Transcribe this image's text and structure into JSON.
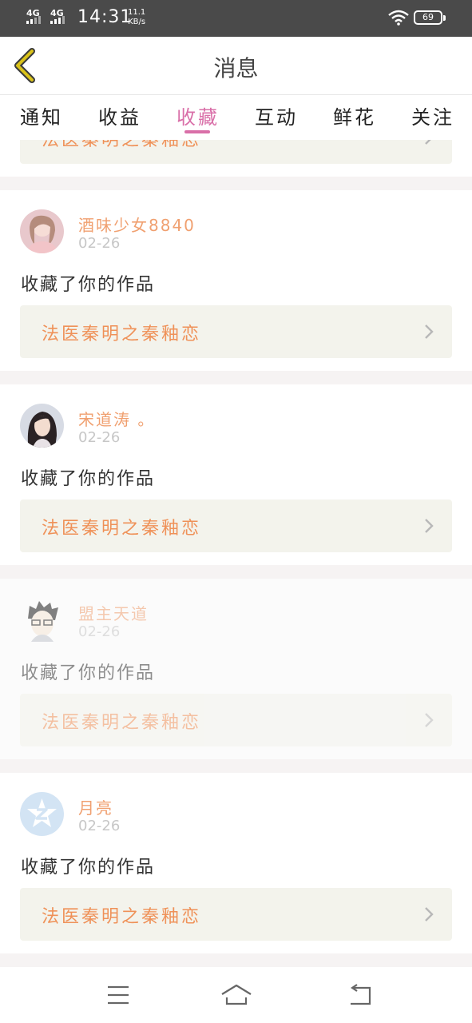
{
  "status_bar": {
    "network_1": "4G",
    "network_2": "4G",
    "time": "14:31",
    "speed_value": "11.1",
    "speed_unit": "KB/s",
    "battery": "69"
  },
  "header": {
    "title": "消息"
  },
  "tabs": [
    {
      "label": "通知"
    },
    {
      "label": "收益"
    },
    {
      "label": "收藏"
    },
    {
      "label": "互动"
    },
    {
      "label": "鲜花"
    },
    {
      "label": "关注"
    }
  ],
  "active_tab": "收藏",
  "colors": {
    "accent": "#d96fa8",
    "username": "#f0a070",
    "work_title": "#ef9158",
    "back_arrow": "#d9c21a"
  },
  "partial_card": {
    "work_title": "法医秦明之秦釉恋"
  },
  "notifications": [
    {
      "user": "酒味少女8840",
      "date": "02-26",
      "action": "收藏了你的作品",
      "work_title": "法医秦明之秦釉恋",
      "avatar": "girl-photo-avatar"
    },
    {
      "user": "宋道涛 。",
      "date": "02-26",
      "action": "收藏了你的作品",
      "work_title": "法医秦明之秦釉恋",
      "avatar": "girl-portrait-avatar"
    },
    {
      "user": "盟主天道",
      "date": "02-26",
      "action": "收藏了你的作品",
      "work_title": "法医秦明之秦釉恋",
      "avatar": "anime-boy-avatar"
    },
    {
      "user": "月亮",
      "date": "02-26",
      "action": "收藏了你的作品",
      "work_title": "法医秦明之秦釉恋",
      "avatar": "default-z-avatar"
    }
  ],
  "nav_bar": {
    "menu": "menu-icon",
    "home": "home-icon",
    "back": "back-icon"
  }
}
